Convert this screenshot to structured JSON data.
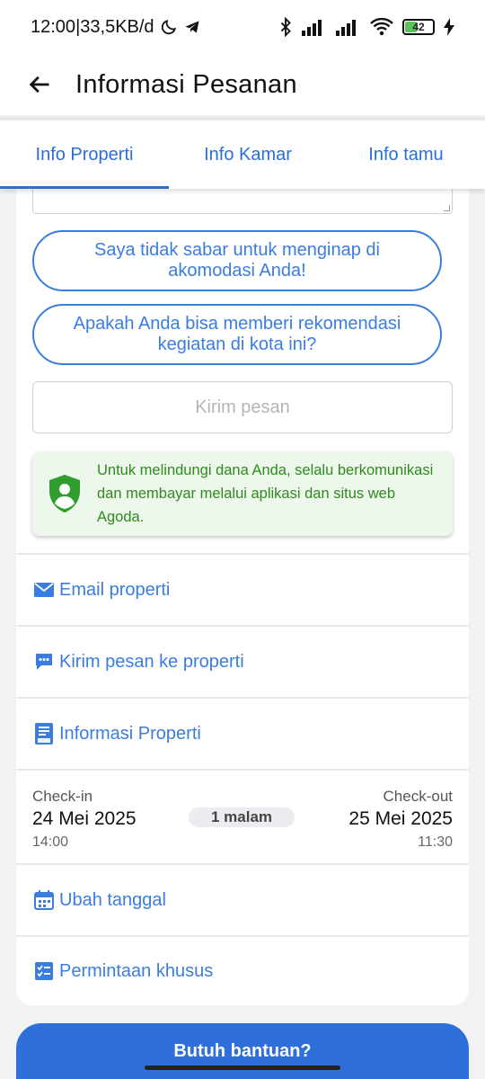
{
  "status_bar": {
    "time": "12:00",
    "separator": " | ",
    "network_speed": "33,5KB/d",
    "battery_level": "42",
    "battery_color": "#5cc35c"
  },
  "app_bar": {
    "title": "Informasi Pesanan"
  },
  "tabs": [
    {
      "label": "Info Properti",
      "active": true
    },
    {
      "label": "Info Kamar",
      "active": false
    },
    {
      "label": "Info tamu",
      "active": false
    }
  ],
  "quick_replies": [
    "Saya tidak sabar untuk menginap di akomodasi Anda!",
    "Apakah Anda bisa memberi rekomendasi kegiatan di kota ini?"
  ],
  "message_input": {
    "placeholder": "Kirim pesan"
  },
  "notice": {
    "text": "Untuk melindungi dana Anda, selalu berkomunikasi dan membayar melalui aplikasi dan situs web Agoda."
  },
  "actions": {
    "email": "Email properti",
    "message": "Kirim pesan ke properti",
    "info": "Informasi Properti",
    "change_date": "Ubah tanggal",
    "special_request": "Permintaan khusus"
  },
  "stay": {
    "checkin_label": "Check-in",
    "checkin_date": "24 Mei 2025",
    "checkin_time": "14:00",
    "nights": "1 malam",
    "checkout_label": "Check-out",
    "checkout_date": "25 Mei 2025",
    "checkout_time": "11:30"
  },
  "help_button": {
    "label": "Butuh bantuan?"
  },
  "colors": {
    "accent": "#2a6fd6",
    "link": "#3b7dde",
    "notice_text": "#2f8a1f",
    "notice_bg": "#eef7ec",
    "primary_button": "#2f6fd9"
  }
}
